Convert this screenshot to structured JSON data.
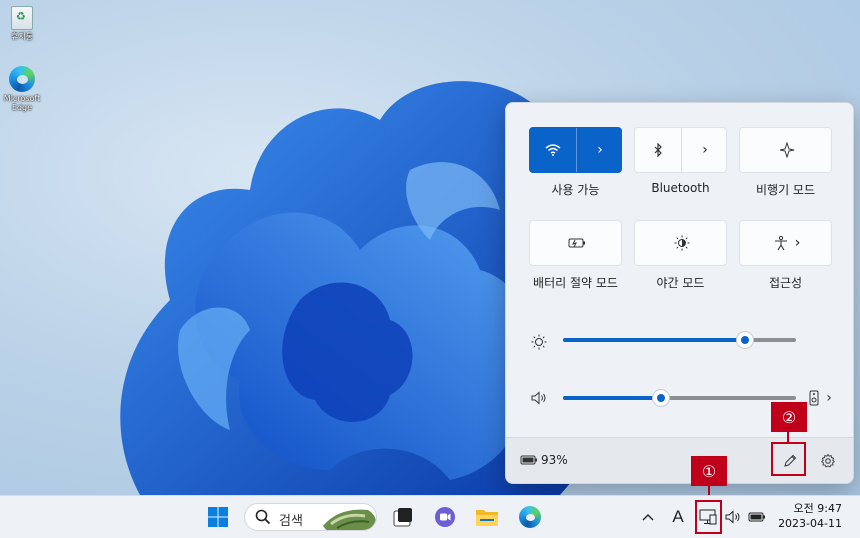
{
  "desktop": {
    "icons": [
      {
        "label": "휴지통",
        "icon": "recycle-bin-icon"
      },
      {
        "label": "Microsoft Edge",
        "icon": "edge-icon"
      }
    ]
  },
  "quick_settings": {
    "tiles": [
      {
        "label": "사용 가능",
        "icon": "wifi-icon",
        "active": true,
        "has_arrow": true
      },
      {
        "label": "Bluetooth",
        "icon": "bluetooth-icon",
        "active": false,
        "has_arrow": true
      },
      {
        "label": "비행기 모드",
        "icon": "airplane-icon",
        "active": false,
        "has_arrow": false
      },
      {
        "label": "배터리 절약 모드",
        "icon": "battery-saver-icon",
        "active": false,
        "has_arrow": false
      },
      {
        "label": "야간 모드",
        "icon": "night-light-icon",
        "active": false,
        "has_arrow": false
      },
      {
        "label": "접근성",
        "icon": "accessibility-icon",
        "active": false,
        "has_arrow": true
      }
    ],
    "brightness": {
      "icon": "brightness-icon",
      "value_fraction": 0.78
    },
    "volume": {
      "icon": "speaker-icon",
      "value_fraction": 0.42,
      "device_icon": "audio-device-icon"
    },
    "footer": {
      "battery_icon": "battery-icon",
      "battery_text": "93%",
      "edit_icon": "pencil-icon",
      "settings_icon": "gear-icon"
    }
  },
  "annotations": {
    "callout_1": "①",
    "callout_2": "②",
    "color": "#c0001a"
  },
  "taskbar": {
    "search_placeholder": "검색",
    "pinned": [
      "start-icon",
      "task-view-icon",
      "teams-chat-icon",
      "file-explorer-icon",
      "edge-icon"
    ],
    "tray": {
      "ime_label": "A"
    },
    "clock": {
      "time": "오전 9:47",
      "date": "2023-04-11"
    }
  },
  "colors": {
    "accent": "#0a63c9",
    "annotation": "#c0001a"
  }
}
